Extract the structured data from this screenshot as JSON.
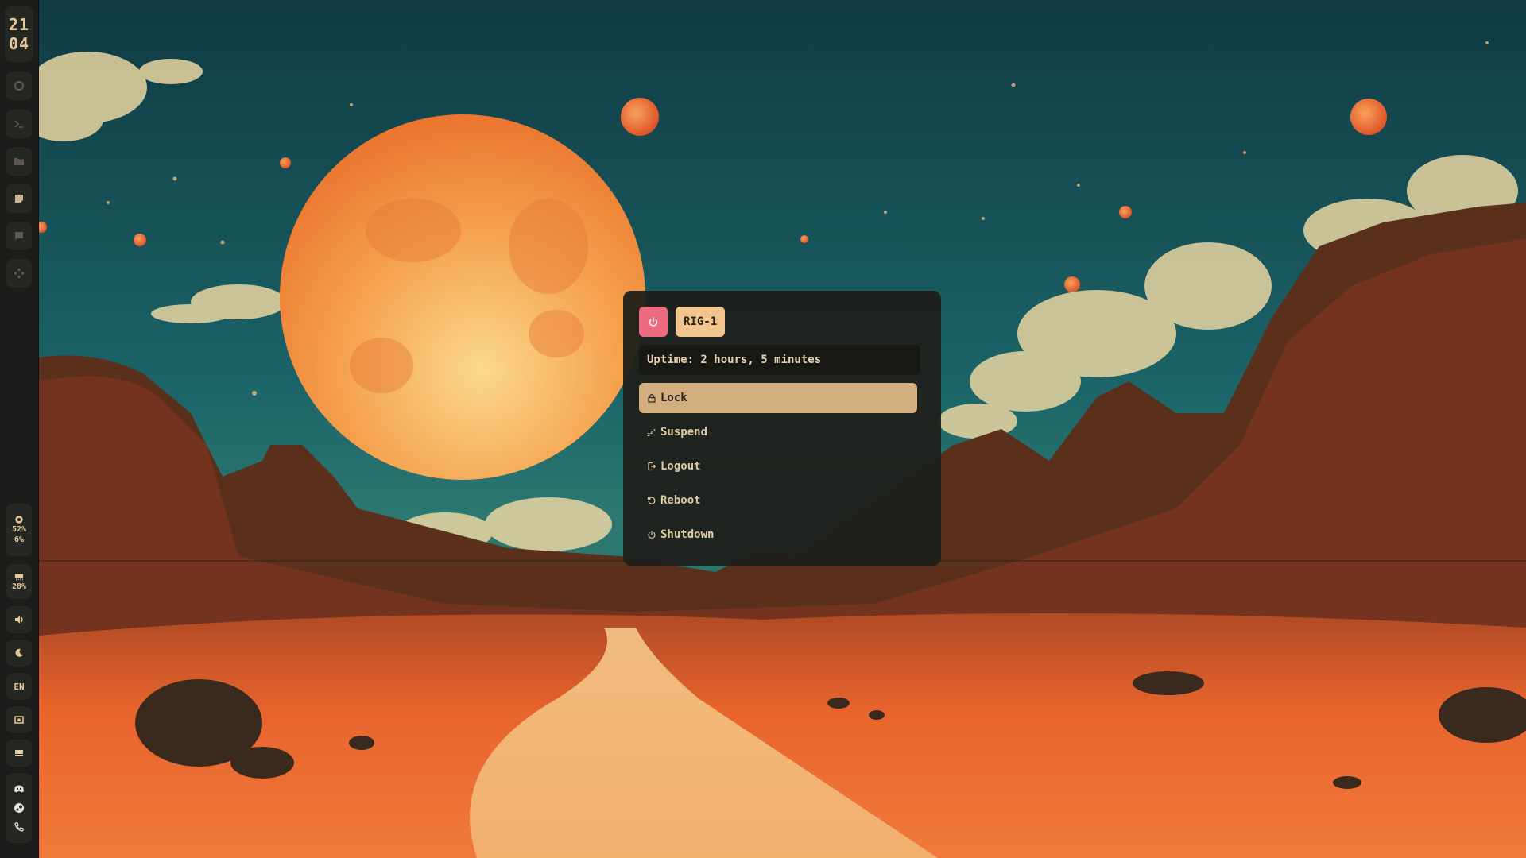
{
  "clock": {
    "hour": "21",
    "minute": "04"
  },
  "bar": {
    "top_icons": [
      "circle-icon",
      "terminal-icon",
      "folder-icon",
      "notes-icon",
      "chat-icon",
      "apps-icon"
    ],
    "stats_group": {
      "icon": "cpu-icon",
      "cpu": "52%",
      "mem": "6%"
    },
    "ram_group": {
      "icon": "memory-icon",
      "value": "28%"
    },
    "keyboard_layout": "EN",
    "bottom_icons": [
      "volume-icon",
      "night-light-icon",
      "screenshot-icon",
      "list-icon"
    ],
    "tray_icons": [
      "discord-icon",
      "steam-icon",
      "phone-icon"
    ]
  },
  "menu": {
    "hostname": "RIG-1",
    "uptime": "Uptime: 2 hours, 5 minutes",
    "items": [
      {
        "label": "Lock",
        "icon": "lock-icon",
        "selected": true
      },
      {
        "label": "Suspend",
        "icon": "sleep-icon",
        "selected": false
      },
      {
        "label": "Logout",
        "icon": "logout-icon",
        "selected": false
      },
      {
        "label": "Reboot",
        "icon": "reboot-icon",
        "selected": false
      },
      {
        "label": "Shutdown",
        "icon": "shutdown-icon",
        "selected": false
      }
    ]
  },
  "colors": {
    "accent_power": "#ed6b80",
    "accent_host": "#f2c58f",
    "selected_item": "#d3af80",
    "bar_bg": "#1c1d1a",
    "menu_bg": "#1f201b",
    "text": "#e0c9a3"
  }
}
